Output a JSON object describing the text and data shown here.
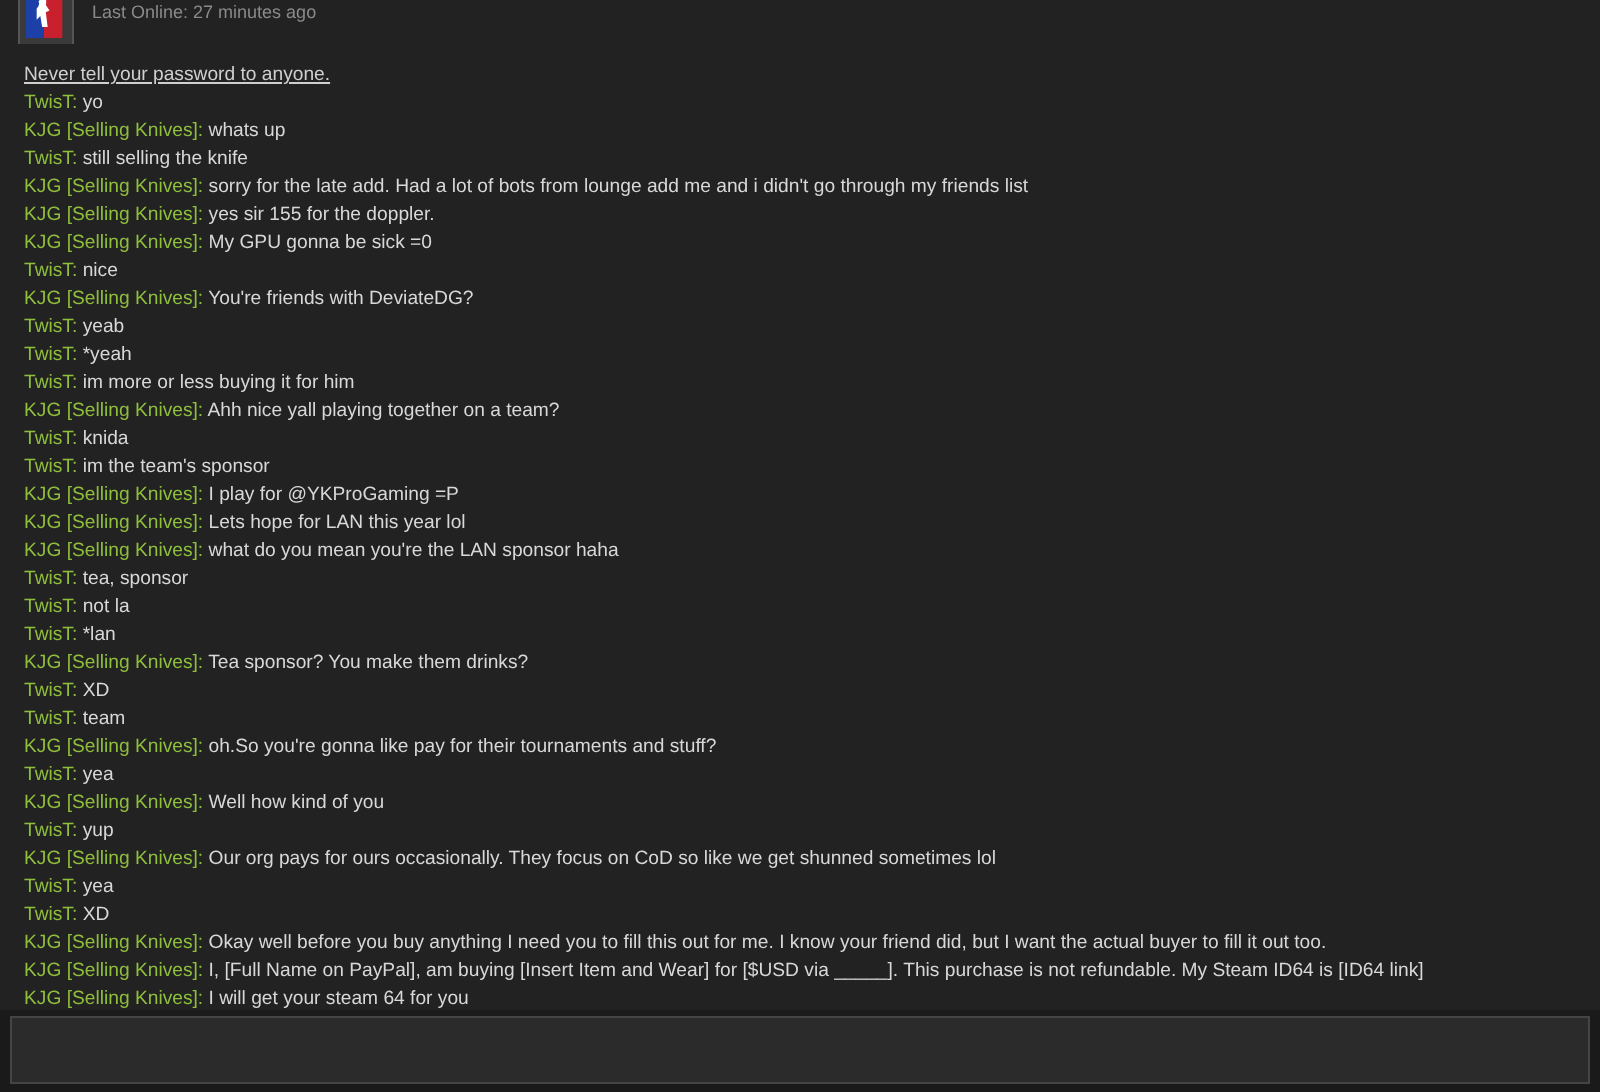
{
  "header": {
    "status": "Last Online: 27 minutes ago"
  },
  "notice": "Never tell your password to anyone.",
  "messages": [
    {
      "sender": "TwisT:",
      "text": "yo"
    },
    {
      "sender": "KJG [Selling Knives]:",
      "text": "whats up"
    },
    {
      "sender": "TwisT:",
      "text": "still selling the knife"
    },
    {
      "sender": "KJG [Selling Knives]:",
      "text": "sorry for the late add. Had a lot of bots from lounge add me and i didn't go through my friends list"
    },
    {
      "sender": "KJG [Selling Knives]:",
      "text": "yes sir 155 for the doppler."
    },
    {
      "sender": "KJG [Selling Knives]:",
      "text": "My GPU gonna be sick =0"
    },
    {
      "sender": "TwisT:",
      "text": "nice"
    },
    {
      "sender": "KJG [Selling Knives]:",
      "text": "You're friends with DeviateDG?"
    },
    {
      "sender": "TwisT:",
      "text": "yeab"
    },
    {
      "sender": "TwisT:",
      "text": "*yeah"
    },
    {
      "sender": "TwisT:",
      "text": "im more or less buying it for him"
    },
    {
      "sender": "KJG [Selling Knives]:",
      "text": "Ahh nice yall playing together on a team?"
    },
    {
      "sender": "TwisT:",
      "text": "knida"
    },
    {
      "sender": "TwisT:",
      "text": "im the team's sponsor"
    },
    {
      "sender": "KJG [Selling Knives]:",
      "text": "I play for @YKProGaming =P"
    },
    {
      "sender": "KJG [Selling Knives]:",
      "text": "Lets hope for LAN this year lol"
    },
    {
      "sender": "KJG [Selling Knives]:",
      "text": "what do you  mean you're the LAN sponsor haha"
    },
    {
      "sender": "TwisT:",
      "text": "tea, sponsor"
    },
    {
      "sender": "TwisT:",
      "text": "not la"
    },
    {
      "sender": "TwisT:",
      "text": "*lan"
    },
    {
      "sender": "KJG [Selling Knives]:",
      "text": "Tea sponsor? You make them drinks?"
    },
    {
      "sender": "TwisT:",
      "text": "XD"
    },
    {
      "sender": "TwisT:",
      "text": "team"
    },
    {
      "sender": "KJG [Selling Knives]:",
      "text": "oh.So you're gonna like pay for their tournaments and stuff?"
    },
    {
      "sender": "TwisT:",
      "text": "yea"
    },
    {
      "sender": "KJG [Selling Knives]:",
      "text": "Well how kind of you"
    },
    {
      "sender": "TwisT:",
      "text": "yup"
    },
    {
      "sender": "KJG [Selling Knives]:",
      "text": "Our org pays for ours occasionally. They focus on CoD so like we get shunned sometimes lol"
    },
    {
      "sender": "TwisT:",
      "text": "yea"
    },
    {
      "sender": "TwisT:",
      "text": "XD"
    },
    {
      "sender": "KJG [Selling Knives]:",
      "text": "Okay well before you buy anything I need you to fill this out for me. I know your friend did, but I want the actual buyer to fill it out too."
    },
    {
      "sender": "KJG [Selling Knives]:",
      "text": "I, [Full Name on PayPal], am buying [Insert Item and Wear] for [$USD via _____]. This purchase is not refundable. My Steam ID64 is [ID64 link]"
    },
    {
      "sender": "KJG [Selling Knives]:",
      "text": "I will get your steam 64 for you"
    }
  ]
}
